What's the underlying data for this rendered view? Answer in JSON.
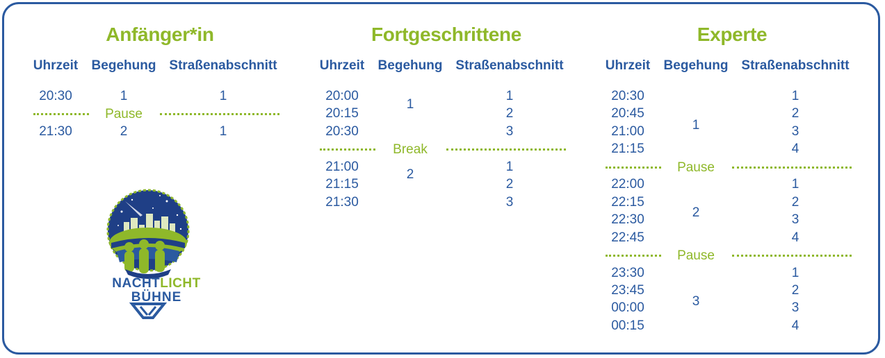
{
  "headers": {
    "time": "Uhrzeit",
    "walk": "Begehung",
    "section": "Straßenabschnitt"
  },
  "beginner": {
    "title": "Anfänger*in",
    "rows": [
      {
        "time": "20:30",
        "walk": "1",
        "section": "1"
      },
      {
        "time": "21:30",
        "walk": "2",
        "section": "1"
      }
    ],
    "pause": "Pause"
  },
  "advanced": {
    "title": "Fortgeschrittene",
    "block1": {
      "walk": "1",
      "times": [
        "20:00",
        "20:15",
        "20:30"
      ],
      "sections": [
        "1",
        "2",
        "3"
      ]
    },
    "break": "Break",
    "block2": {
      "walk": "2",
      "times": [
        "21:00",
        "21:15",
        "21:30"
      ],
      "sections": [
        "1",
        "2",
        "3"
      ]
    }
  },
  "expert": {
    "title": "Experte",
    "block1": {
      "walk": "1",
      "times": [
        "20:30",
        "20:45",
        "21:00",
        "21:15"
      ],
      "sections": [
        "1",
        "2",
        "3",
        "4"
      ]
    },
    "pause1": "Pause",
    "block2": {
      "walk": "2",
      "times": [
        "22:00",
        "22:15",
        "22:30",
        "22:45"
      ],
      "sections": [
        "1",
        "2",
        "3",
        "4"
      ]
    },
    "pause2": "Pause",
    "block3": {
      "walk": "3",
      "times": [
        "23:30",
        "23:45",
        "00:00",
        "00:15"
      ],
      "sections": [
        "1",
        "2",
        "3",
        "4"
      ]
    }
  },
  "logo": {
    "word1_a": "NACHT",
    "word1_b": "LICHT",
    "word2": "BÜHNE"
  },
  "colors": {
    "blue": "#2b5aa0",
    "green": "#8fb82a"
  }
}
